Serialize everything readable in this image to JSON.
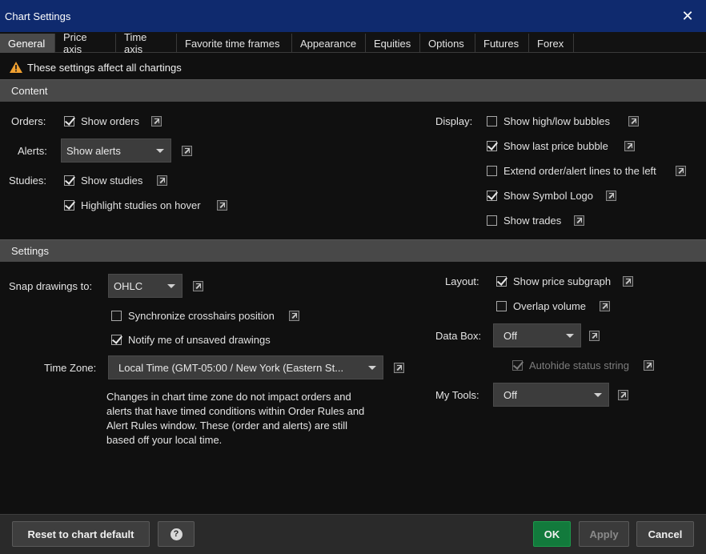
{
  "window": {
    "title": "Chart Settings"
  },
  "tabs": [
    {
      "label": "General",
      "active": true
    },
    {
      "label": "Price axis"
    },
    {
      "label": "Time axis"
    },
    {
      "label": "Favorite time frames"
    },
    {
      "label": "Appearance"
    },
    {
      "label": "Equities"
    },
    {
      "label": "Options"
    },
    {
      "label": "Futures"
    },
    {
      "label": "Forex"
    }
  ],
  "warning": {
    "text": "These settings affect all chartings",
    "icon": "warning-icon",
    "color": "#f0a030"
  },
  "content": {
    "header": "Content",
    "orders_label": "Orders:",
    "show_orders": {
      "label": "Show orders",
      "checked": true
    },
    "alerts_label": "Alerts:",
    "alerts_select": "Show alerts",
    "studies_label": "Studies:",
    "show_studies": {
      "label": "Show studies",
      "checked": true
    },
    "highlight_studies": {
      "label": "Highlight studies on hover",
      "checked": true
    },
    "display_label": "Display:",
    "display": [
      {
        "label": "Show high/low bubbles",
        "checked": false
      },
      {
        "label": "Show last price bubble",
        "checked": true
      },
      {
        "label": "Extend order/alert lines to the left",
        "checked": false
      },
      {
        "label": "Show Symbol Logo",
        "checked": true
      },
      {
        "label": "Show trades",
        "checked": false
      }
    ]
  },
  "settings": {
    "header": "Settings",
    "snap_label": "Snap drawings to:",
    "snap_select": "OHLC",
    "sync_crosshairs": {
      "label": "Synchronize crosshairs position",
      "checked": false
    },
    "notify_unsaved": {
      "label": "Notify me of unsaved drawings",
      "checked": true
    },
    "timezone_label": "Time Zone:",
    "timezone_select": "Local Time (GMT-05:00 / New York (Eastern St...",
    "timezone_note": "Changes in chart time zone do not impact orders and alerts that have timed conditions within Order Rules and Alert Rules window. These (order and alerts) are still based off your local time.",
    "layout_label": "Layout:",
    "show_price_subgraph": {
      "label": "Show price subgraph",
      "checked": true
    },
    "overlap_volume": {
      "label": "Overlap volume",
      "checked": false
    },
    "databox_label": "Data Box:",
    "databox_select": "Off",
    "autohide_status": {
      "label": "Autohide status string",
      "checked": true,
      "disabled": true
    },
    "mytools_label": "My Tools:",
    "mytools_select": "Off"
  },
  "footer": {
    "reset_label": "Reset to chart default",
    "help_symbol": "?",
    "ok_label": "OK",
    "apply_label": "Apply",
    "cancel_label": "Cancel",
    "ok_color": "#127a3c"
  }
}
